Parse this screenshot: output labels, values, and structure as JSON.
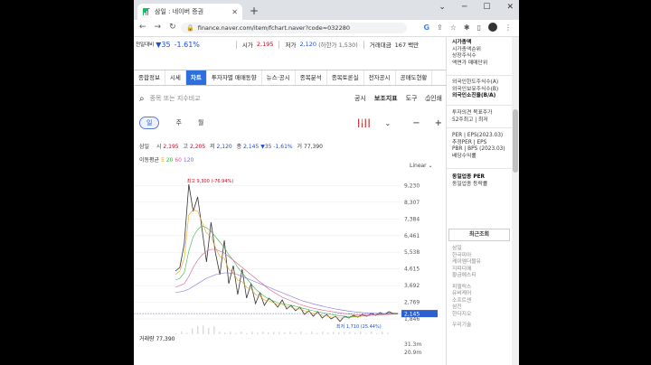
{
  "browser": {
    "tab_title": "삼일 : 네이버 증권",
    "url": "finance.naver.com/item/fchart.naver?code=032280"
  },
  "price_header": {
    "prefix": "전일대비",
    "change": "▼35",
    "change_pct": "-1.61%",
    "open_label": "시가",
    "open": "2,195",
    "low_label": "저가",
    "low": "2,120",
    "low_limit": "(하한가 1,530)",
    "amount_label": "거래대금",
    "amount": "167 백만"
  },
  "tabs": [
    {
      "label": "종합정보"
    },
    {
      "label": "시세"
    },
    {
      "label": "차트",
      "active": true
    },
    {
      "label": "투자자별 매매동향"
    },
    {
      "label": "뉴스·공시"
    },
    {
      "label": "종목분석"
    },
    {
      "label": "종목토론실"
    },
    {
      "label": "전자공시"
    },
    {
      "label": "공매도현황"
    }
  ],
  "toolbar": {
    "search_placeholder": "종목 또는 지수비교",
    "disclosure": "공시",
    "indicators": "보조지표",
    "tools": "도구",
    "print": "인쇄"
  },
  "periods": {
    "day": "일",
    "week": "주",
    "month": "월"
  },
  "ohlc": {
    "name": "삼일",
    "open_label": "시",
    "open": "2,195",
    "high_label": "고",
    "high": "2,205",
    "low_label": "저",
    "low": "2,120",
    "close_label": "종",
    "close": "2,145",
    "change": "▼35",
    "pct": "-1.61%",
    "vol_label": "거",
    "volume": "77,390"
  },
  "moving_avg": {
    "label": "이동평균",
    "ma5": "5",
    "ma20": "20",
    "ma60": "60",
    "ma120": "120"
  },
  "scale": "Linear",
  "chart_data": {
    "type": "line",
    "y_ticks": [
      "9,230",
      "8,307",
      "7,384",
      "6,461",
      "5,538",
      "4,615",
      "3,692",
      "2,769",
      "1,846"
    ],
    "ylim": [
      1700,
      9600
    ],
    "current_price": "2,145",
    "current_value": 2145,
    "max_annotation": "최고 9,300 (-76.94%)",
    "max_value": 9300,
    "min_annotation": "최저 1,710 (25.44%)",
    "min_value": 1710,
    "series": [
      {
        "color": "#333333",
        "values": [
          4500,
          4700,
          6000,
          9300,
          7800,
          8600,
          6800,
          5000,
          7200,
          5500,
          4300,
          6200,
          3800,
          4800,
          3200,
          4600,
          3000,
          3800,
          2700,
          3300,
          2600,
          3000,
          2800,
          2500,
          2900,
          2400,
          2600,
          2300,
          2500,
          2100,
          2300,
          2000,
          2250,
          1900,
          2100,
          1850,
          2000,
          1710,
          2000,
          1900,
          2050,
          1950,
          2100,
          2000,
          2150,
          2050,
          2200,
          2100,
          2250,
          2150,
          2145
        ]
      },
      {
        "color": "#e8a317",
        "values": [
          4300,
          4500,
          5200,
          7600,
          7900,
          7800,
          7200,
          6600,
          6400,
          5800,
          5300,
          5200,
          4600,
          4400,
          4000,
          3900,
          3600,
          3500,
          3200,
          3100,
          2900,
          2850,
          2750,
          2650,
          2650,
          2550,
          2500,
          2400,
          2400,
          2300,
          2250,
          2150,
          2150,
          2050,
          2000,
          1950,
          1950,
          1900,
          1920,
          1930,
          1960,
          1970,
          2000,
          2020,
          2060,
          2070,
          2110,
          2120,
          2160,
          2170,
          2170
        ]
      },
      {
        "color": "#3ab54a",
        "values": [
          4000,
          4100,
          4400,
          5600,
          6400,
          6800,
          7000,
          6900,
          6700,
          6400,
          6100,
          5800,
          5400,
          5100,
          4700,
          4400,
          4100,
          3800,
          3500,
          3300,
          3100,
          2950,
          2850,
          2750,
          2700,
          2650,
          2600,
          2550,
          2480,
          2420,
          2360,
          2300,
          2250,
          2200,
          2150,
          2100,
          2060,
          2020,
          2000,
          1990,
          1990,
          2000,
          2010,
          2030,
          2050,
          2070,
          2090,
          2110,
          2130,
          2150,
          2160
        ]
      },
      {
        "color": "#d65c8a",
        "values": [
          3600,
          3700,
          3800,
          4200,
          4700,
          5100,
          5400,
          5600,
          5700,
          5700,
          5600,
          5500,
          5300,
          5100,
          4900,
          4700,
          4500,
          4300,
          4100,
          3900,
          3700,
          3500,
          3350,
          3200,
          3050,
          2950,
          2850,
          2750,
          2650,
          2570,
          2500,
          2440,
          2390,
          2340,
          2300,
          2260,
          2220,
          2180,
          2150,
          2120,
          2100,
          2080,
          2070,
          2060,
          2060,
          2070,
          2080,
          2090,
          2100,
          2110,
          2120
        ]
      },
      {
        "color": "#7a6bd8",
        "values": [
          3300,
          3350,
          3400,
          3500,
          3650,
          3800,
          3950,
          4100,
          4200,
          4300,
          4350,
          4400,
          4400,
          4350,
          4300,
          4200,
          4100,
          4000,
          3900,
          3800,
          3700,
          3600,
          3500,
          3400,
          3300,
          3200,
          3100,
          3000,
          2900,
          2820,
          2750,
          2680,
          2620,
          2560,
          2500,
          2450,
          2400,
          2360,
          2320,
          2280,
          2250,
          2220,
          2200,
          2180,
          2170,
          2160,
          2150,
          2150,
          2150,
          2150,
          2150
        ]
      }
    ]
  },
  "volume": {
    "label": "거래량",
    "value": "77,390",
    "ticks": [
      "31.3m",
      "20.9m"
    ]
  },
  "sidebar": {
    "market_cap_title": "시가총액",
    "market_cap_items": [
      "시가총액순위",
      "상장주식수",
      "액면가   매매단위"
    ],
    "foreign_items": [
      "외국인한도주식수(A)",
      "외국인보유주식수(B)"
    ],
    "foreign_ratio": "외국인소진율(B/A)",
    "opinion_items": [
      "투자의견   목표주가",
      "52주최고 | 최저"
    ],
    "per_items": [
      "PER | EPS(2023.03)",
      "추정PER | EPS",
      "PBR | BPS (2023.03)",
      "배당수익률"
    ],
    "sector_title": "동일업종 PER",
    "sector_change": "동일업종 등락률",
    "recent_title": "최근조회",
    "recent_items": [
      "삼일",
      "한국피아",
      "케이엠더블유",
      "지피디에",
      "황금에스티",
      "피델릭스",
      "유비케어",
      "소프트센",
      "삼진",
      "한다지오",
      "우리기술"
    ]
  }
}
